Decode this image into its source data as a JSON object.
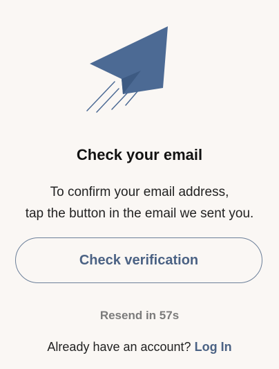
{
  "theme": {
    "background": "#faf7f4",
    "accent": "#4b6284",
    "plane": "#4c6a94"
  },
  "illustration": {
    "icon": "paper-plane-icon"
  },
  "title": "Check your email",
  "description": {
    "line1": "To confirm your email address,",
    "line2": "tap the button in the email we sent you."
  },
  "check_button": {
    "label": "Check verification"
  },
  "resend": {
    "label": "Resend in 57s"
  },
  "login": {
    "prompt": "Already have an account?",
    "link_label": "Log In"
  }
}
